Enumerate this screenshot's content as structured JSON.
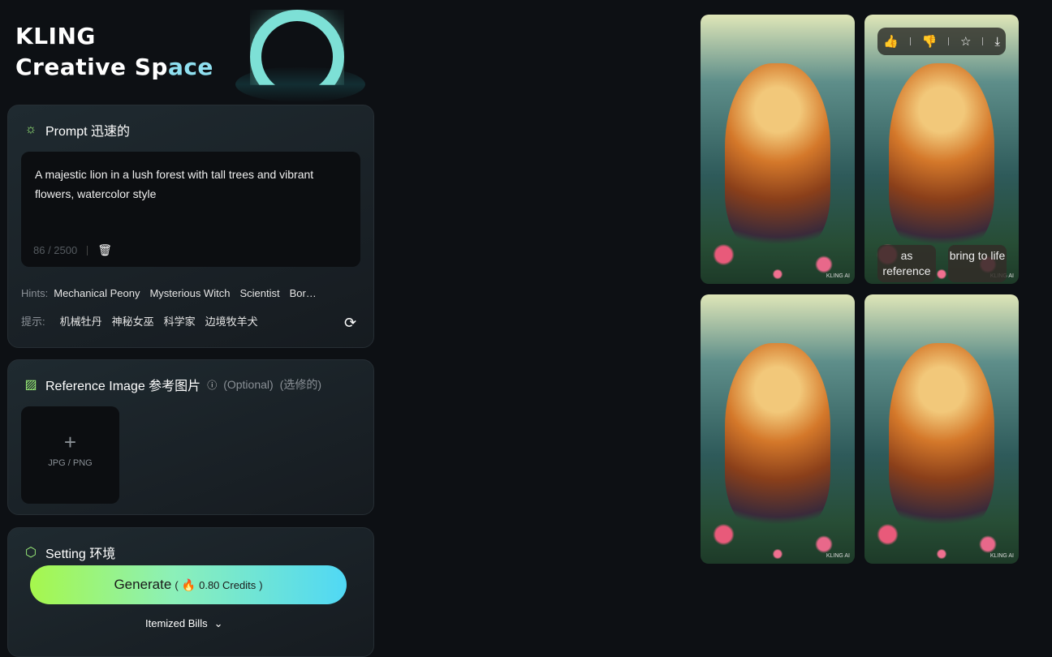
{
  "brand": {
    "line1": "KLING",
    "line2a": "Creative Sp",
    "line2b": "ace"
  },
  "prompt": {
    "title": "Prompt 迅速的",
    "text": "A majestic lion in a lush forest with tall trees and vibrant flowers, watercolor style",
    "count": "86 / 2500",
    "hints_label": "Hints:",
    "hints": [
      "Mechanical Peony",
      "Mysterious Witch",
      "Scientist",
      "Bor…"
    ],
    "hints_cn_label": "提示:",
    "hints_cn": [
      "机械牡丹",
      "神秘女巫",
      "科学家",
      "边境牧羊犬"
    ]
  },
  "reference": {
    "title": "Reference Image 参考图片",
    "optional": "(Optional)",
    "optional_cn": "(选修的)",
    "upload_hint": "JPG / PNG"
  },
  "setting": {
    "title": "Setting 环境"
  },
  "generate": {
    "label": "Generate",
    "open": "(",
    "credits": "0.80 Credits",
    "close": ")"
  },
  "bills": {
    "label": "Itemized Bills"
  },
  "images": {
    "watermark": "KLING AI",
    "actions": {
      "reference": "as reference",
      "animate": "bring to life"
    }
  },
  "colors": {
    "accent_green": "#a6f74c",
    "accent_cyan": "#50d8f5",
    "bg": "#0d1014"
  }
}
